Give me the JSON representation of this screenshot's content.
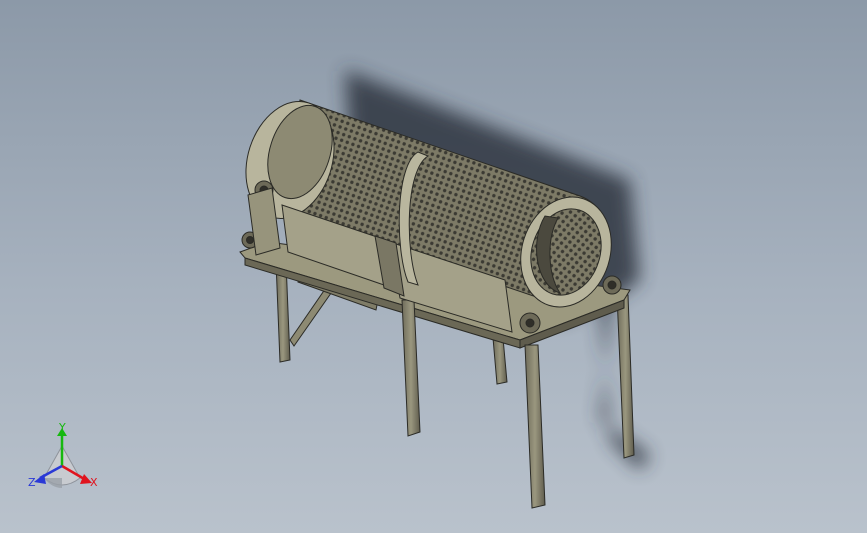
{
  "viewport": {
    "background_top": "#8c99a8",
    "background_bottom": "#b9c2cc"
  },
  "model": {
    "part_color": "#8d8a73",
    "part_edge_color": "#2b2b26",
    "shadow_color": "#2e3440"
  },
  "triad": {
    "x_label": "X",
    "y_label": "Y",
    "z_label": "Z",
    "x_color": "#e0141e",
    "y_color": "#16b80f",
    "z_color": "#2a39d6"
  }
}
